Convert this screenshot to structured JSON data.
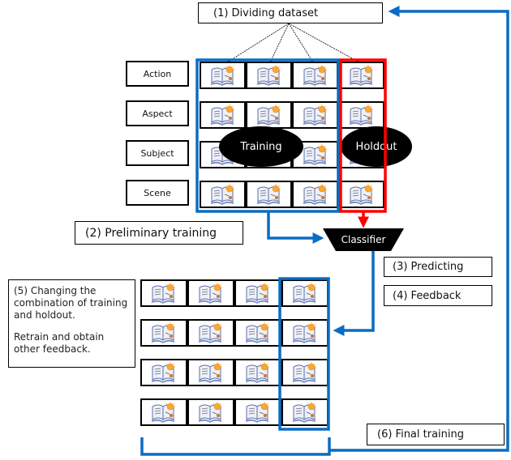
{
  "title_box": {
    "label": "(1) Dividing dataset"
  },
  "row_labels": [
    "Action",
    "Aspect",
    "Subject",
    "Scene"
  ],
  "groups": {
    "training": "Training",
    "holdout": "Holdout"
  },
  "steps": {
    "preliminary": "(2) Preliminary training",
    "classifier": "Classifier",
    "predicting": "(3) Predicting",
    "feedback": "(4) Feedback",
    "changing_line1": "(5) Changing the combination of training and holdout.",
    "changing_line2": "Retrain and obtain other feedback.",
    "final": "(6) Final training"
  },
  "icon": "book-with-lightbulb-icon",
  "colors": {
    "training_border": "#0a6cc4",
    "holdout_border": "#ff0000",
    "arrow_blue": "#0a6cc4",
    "arrow_red": "#ff0000",
    "ellipse": "#000000"
  },
  "grids": {
    "top": {
      "rows": 4,
      "cols": 4,
      "holdout_column": 4
    },
    "bottom": {
      "rows": 4,
      "cols": 4,
      "holdout_column": 4
    }
  }
}
